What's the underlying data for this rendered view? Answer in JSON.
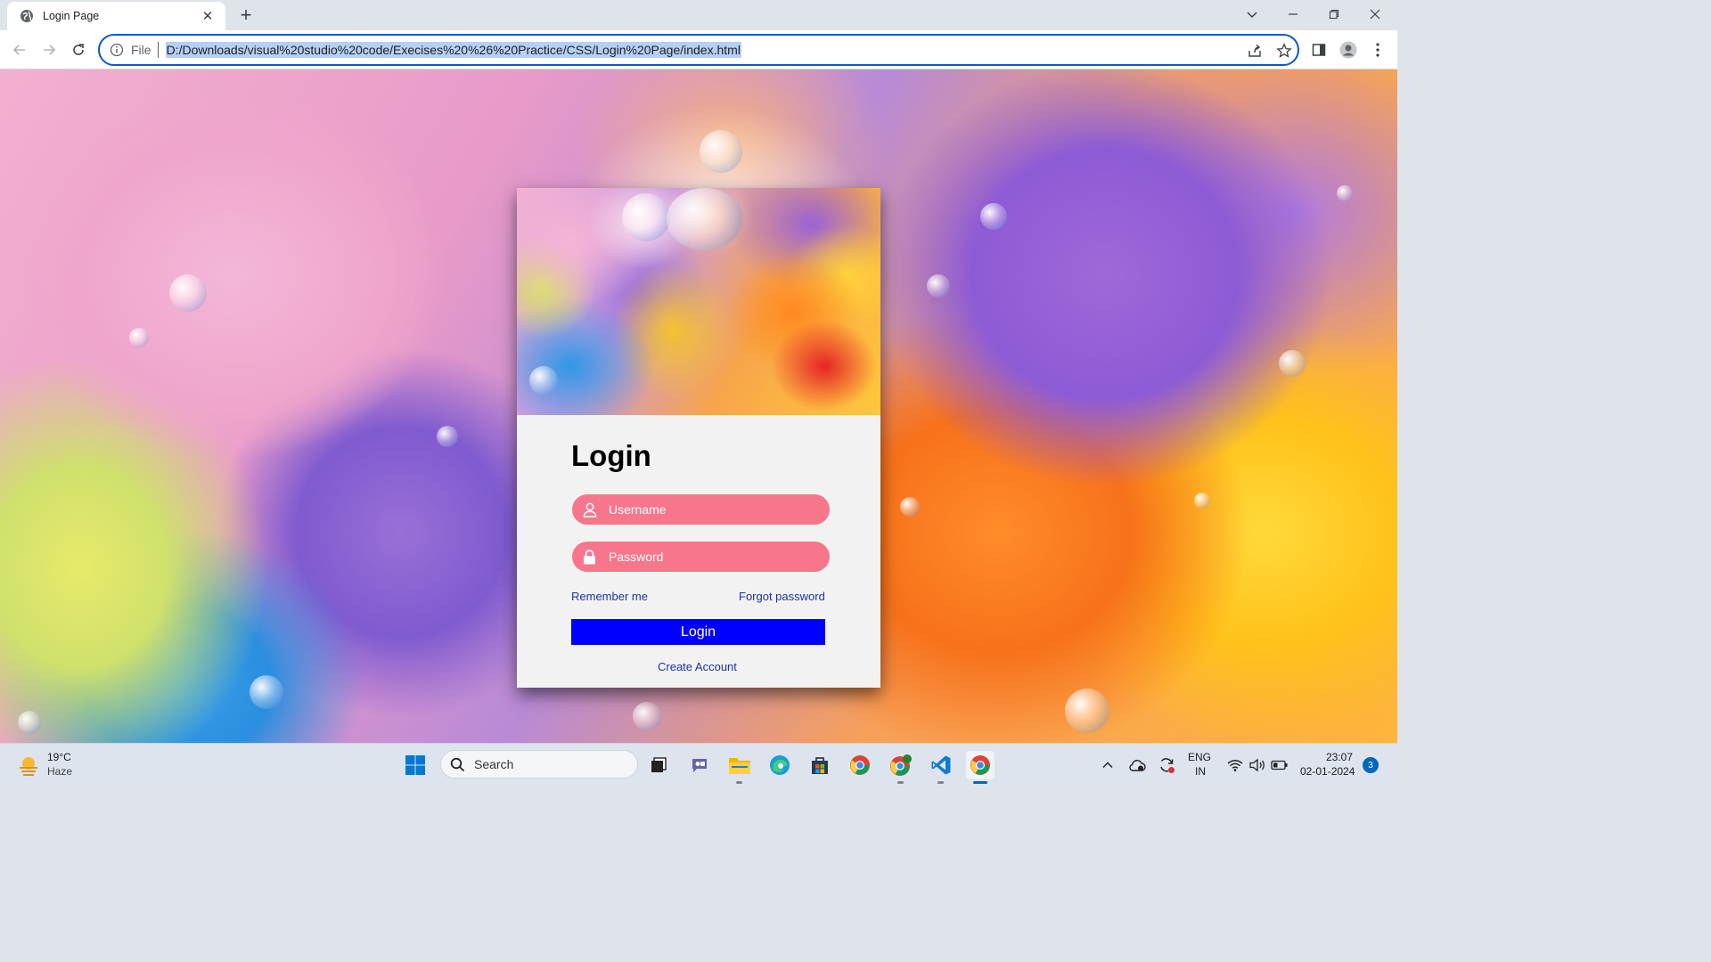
{
  "browser": {
    "tab_title": "Login Page",
    "tab_close": "✕",
    "new_tab": "+",
    "file_label": "File",
    "url": "D:/Downloads/visual%20studio%20code/Execises%20%26%20Practice/CSS/Login%20Page/index.html"
  },
  "login": {
    "title": "Login",
    "username_placeholder": "Username",
    "password_placeholder": "Password",
    "remember_label": "Remember me",
    "forgot_label": "Forgot password",
    "button_label": "Login",
    "create_account_label": "Create Account"
  },
  "taskbar": {
    "weather_temp": "19°C",
    "weather_desc": "Haze",
    "search_label": "Search",
    "language_line1": "ENG",
    "language_line2": "IN",
    "time": "23:07",
    "date": "02-01-2024",
    "notification_count": "3"
  },
  "colors": {
    "field_bg": "#f7768b",
    "button_bg": "#0000ff",
    "link": "#1a33a8",
    "url_highlight": "#b6cff5"
  }
}
